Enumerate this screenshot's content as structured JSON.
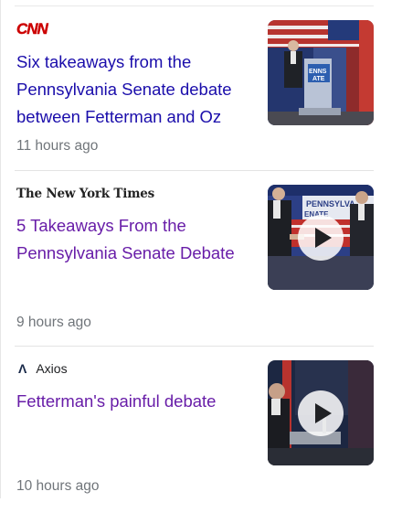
{
  "stories": [
    {
      "source": {
        "name": "CNN",
        "logo_text": "CNN",
        "icon": "cnn-logo-icon"
      },
      "headline": "Six takeaways from the Pennsylvania Senate debate between Fetterman and Oz",
      "headline_lines": [
        "Six takeaways from the",
        "Pennsylvania Senate debate",
        "between Fetterman and Oz"
      ],
      "time": "11 hours ago",
      "has_video": false,
      "visited": false
    },
    {
      "source": {
        "name": "The New York Times",
        "logo_text": "The New York Times",
        "icon": "nyt-logo-icon"
      },
      "headline": "5 Takeaways From the Pennsylvania Senate Debate",
      "headline_lines": [
        "5 Takeaways From the",
        "Pennsylvania Senate Debate"
      ],
      "time": "9 hours ago",
      "has_video": true,
      "visited": true
    },
    {
      "source": {
        "name": "Axios",
        "logo_text": "Axios",
        "icon": "axios-logo-icon"
      },
      "headline": "Fetterman's painful debate",
      "headline_lines": [
        "Fetterman's painful debate"
      ],
      "time": "10 hours ago",
      "has_video": true,
      "visited": true
    }
  ],
  "thumbnail_texts": {
    "cnn_podium": [
      "ENNS",
      "ATE"
    ],
    "nyt_banner": [
      "PENNSYLVA",
      "ENATE"
    ]
  },
  "colors": {
    "link_unvisited": "#1a0dab",
    "link_visited": "#681da8",
    "timestamp": "#70757a",
    "cnn_red": "#cc0000"
  }
}
